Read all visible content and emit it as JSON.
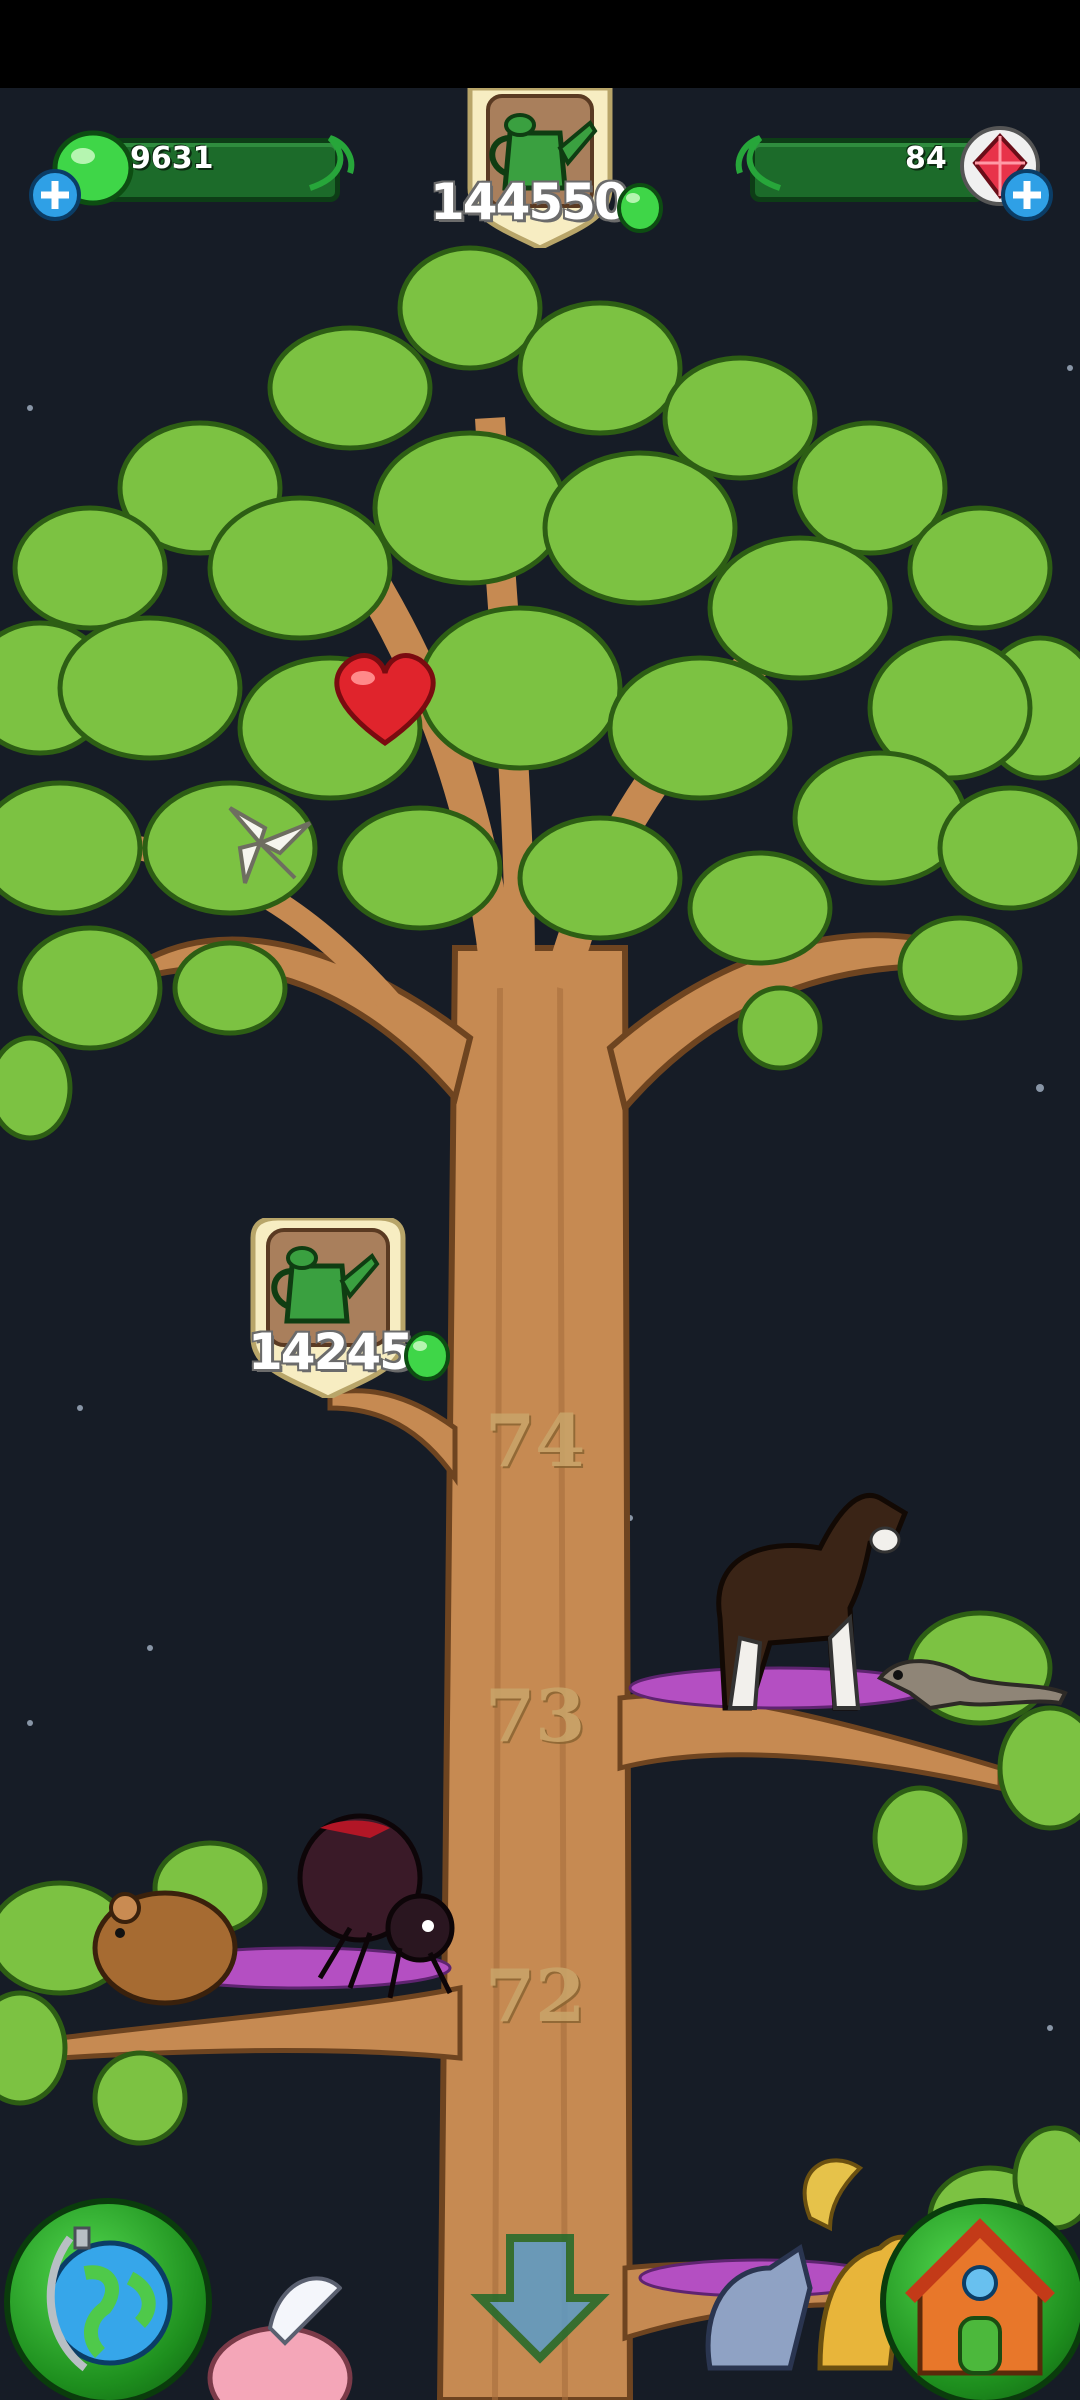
{
  "hud": {
    "gems_count": "9631",
    "premium_count": "84",
    "top_goal_value": "144550",
    "branch_goal_value": "14245"
  },
  "levels": [
    "74",
    "73",
    "72"
  ],
  "icons": {
    "currency": "green-gem-icon",
    "premium": "red-crystal-icon",
    "add": "plus-icon",
    "watering": "watering-can-icon",
    "map": "globe-icon",
    "home": "house-icon",
    "down": "down-arrow-icon"
  },
  "colors": {
    "background": "#161c26",
    "bar": "#1c6b2a",
    "leaf": "#7cc242",
    "trunk": "#c68a52"
  }
}
